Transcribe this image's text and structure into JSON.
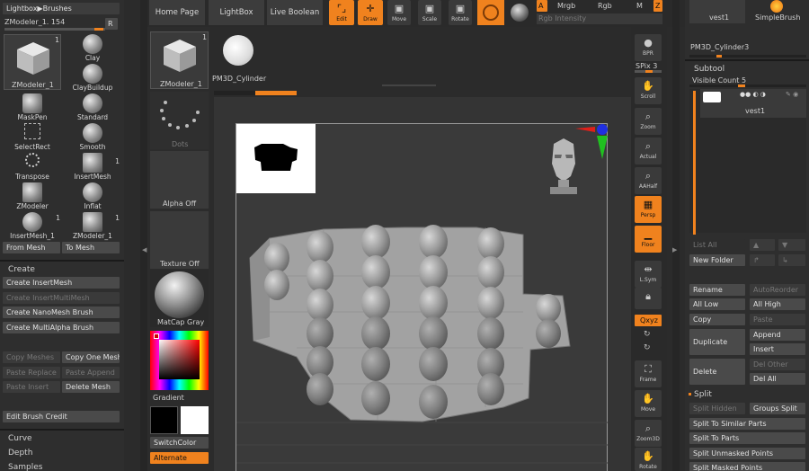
{
  "left": {
    "lightbox_label": "Lightbox▶Brushes",
    "brush_name": "ZModeler_1. 154",
    "r_label": "R",
    "current_brush": "ZModeler_1",
    "brushes": [
      {
        "label": "Clay"
      },
      {
        "label": "ClayBuildup"
      },
      {
        "label": "MaskPen"
      },
      {
        "label": "Standard"
      },
      {
        "label": "SelectRect"
      },
      {
        "label": "Smooth"
      },
      {
        "label": "Transpose"
      },
      {
        "label": "InsertMesh"
      },
      {
        "label": "ZModeler"
      },
      {
        "label": "Inflat"
      },
      {
        "label": "InsertMesh_1"
      },
      {
        "label": "ZModeler_1"
      }
    ],
    "badge": "1",
    "from_mesh": "From Mesh",
    "to_mesh": "To Mesh",
    "create_header": "Create",
    "create_items": [
      "Create InsertMesh",
      "Create InsertMultiMesh",
      "Create NanoMesh Brush",
      "Create MultiAlpha Brush"
    ],
    "copy_meshes": "Copy Meshes",
    "copy_one_mesh": "Copy One Mesh",
    "paste_replace": "Paste Replace",
    "paste_append": "Paste Append",
    "paste_insert": "Paste Insert",
    "delete_mesh": "Delete Mesh",
    "edit_brush_credit": "Edit Brush Credit",
    "curve": "Curve",
    "depth": "Depth",
    "samples": "Samples"
  },
  "tray": {
    "zmodeler_label": "ZModeler_1",
    "dots_label": "Dots",
    "alpha_label": "Alpha Off",
    "texture_label": "Texture Off",
    "matcap_label": "MatCap Gray",
    "gradient_label": "Gradient",
    "switchcolor_label": "SwitchColor",
    "alternate_label": "Alternate",
    "pm3d_label": "PM3D_Cylinder"
  },
  "top": {
    "home_page": "Home Page",
    "lightbox": "LightBox",
    "live_boolean": "Live Boolean",
    "edit": "Edit",
    "draw": "Draw",
    "move": "Move",
    "scale": "Scale",
    "rotate": "Rotate",
    "a_label": "A",
    "mrgb": "Mrgb",
    "rgb": "Rgb",
    "m_label": "M",
    "z_label": "Z",
    "rgb_intensity": "Rgb Intensity"
  },
  "rightbar": {
    "bpr": "BPR",
    "spix": "SPix 3",
    "scroll": "Scroll",
    "zoom": "Zoom",
    "actual": "Actual",
    "aahalf": "AAHalf",
    "persp": "Persp",
    "floor": "Floor",
    "lsym": "L.Sym",
    "xyz": "Qxyz",
    "frame": "Frame",
    "move": "Move",
    "zoom3d": "Zoom3D",
    "rotate": "Rotate"
  },
  "right": {
    "vest_label": "vest1",
    "simplebrush_label": "SimpleBrush",
    "pm3d_label": "PM3D_Cylinder3",
    "subtool_header": "Subtool",
    "visible_count": "Visible Count 5",
    "subtool_name": "vest1",
    "list_all": "List All",
    "new_folder": "New Folder",
    "rename": "Rename",
    "autoreorder": "AutoReorder",
    "all_low": "All Low",
    "all_high": "All High",
    "copy": "Copy",
    "paste": "Paste",
    "duplicate": "Duplicate",
    "append": "Append",
    "insert": "Insert",
    "delete": "Delete",
    "del_other": "Del Other",
    "del_all": "Del All",
    "split_header": "Split",
    "split_hidden": "Split Hidden",
    "groups_split": "Groups Split",
    "split_similar": "Split To Similar Parts",
    "split_parts": "Split To Parts",
    "split_unmasked": "Split Unmasked Points",
    "split_masked": "Split Masked Points"
  }
}
